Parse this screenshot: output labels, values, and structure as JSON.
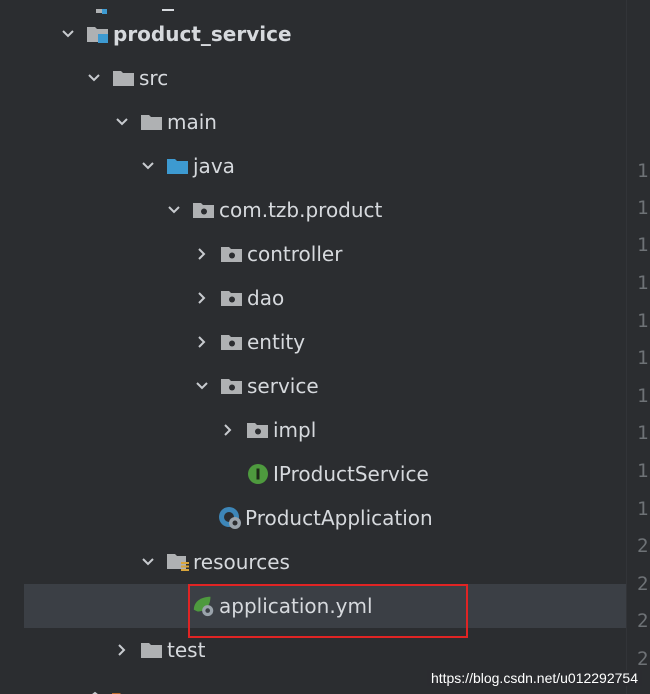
{
  "tree": {
    "items": [
      {
        "label": "product_service",
        "icon": "module-folder",
        "chevron": "down",
        "bold": true
      },
      {
        "label": "src",
        "icon": "folder",
        "chevron": "down"
      },
      {
        "label": "main",
        "icon": "folder",
        "chevron": "down"
      },
      {
        "label": "java",
        "icon": "source-folder",
        "chevron": "down"
      },
      {
        "label": "com.tzb.product",
        "icon": "package",
        "chevron": "down"
      },
      {
        "label": "controller",
        "icon": "package",
        "chevron": "right"
      },
      {
        "label": "dao",
        "icon": "package",
        "chevron": "right"
      },
      {
        "label": "entity",
        "icon": "package",
        "chevron": "right"
      },
      {
        "label": "service",
        "icon": "package",
        "chevron": "down"
      },
      {
        "label": "impl",
        "icon": "package",
        "chevron": "right"
      },
      {
        "label": "IProductService",
        "icon": "interface",
        "chevron": "none"
      },
      {
        "label": "ProductApplication",
        "icon": "spring-app",
        "chevron": "none"
      },
      {
        "label": "resources",
        "icon": "resources-folder",
        "chevron": "down"
      },
      {
        "label": "application.yml",
        "icon": "spring-yml",
        "chevron": "none",
        "selected": true
      },
      {
        "label": "test",
        "icon": "folder",
        "chevron": "right"
      }
    ]
  },
  "gutter": {
    "numbers": [
      "1",
      "1",
      "1",
      "1",
      "1",
      "1",
      "1",
      "1",
      "1",
      "1",
      "2",
      "2",
      "2",
      "2"
    ]
  },
  "watermark": "https://blog.csdn.net/u012292754",
  "colors": {
    "background": "#2b2d30",
    "selected_row": "#3b3f45",
    "highlight_border": "#e02424",
    "folder_gray": "#afb1b3",
    "source_blue": "#3d9ad1",
    "interface_green": "#4e9a3e"
  }
}
